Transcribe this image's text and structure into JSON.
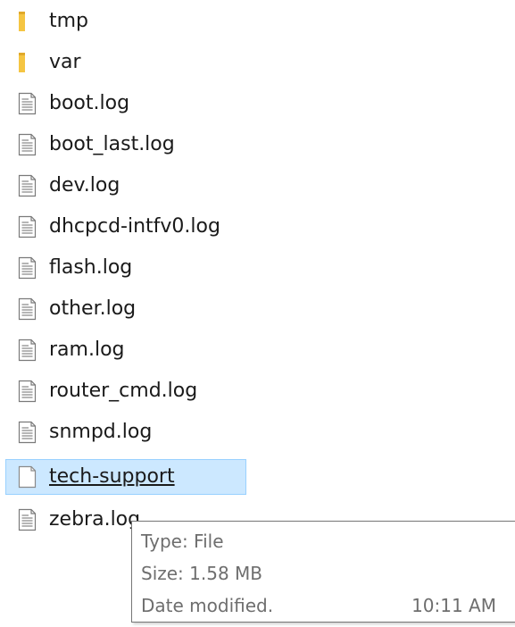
{
  "files": [
    {
      "name": "tmp",
      "icon": "folder-icon",
      "selected": false
    },
    {
      "name": "var",
      "icon": "folder-icon",
      "selected": false
    },
    {
      "name": "boot.log",
      "icon": "text-file-icon",
      "selected": false
    },
    {
      "name": "boot_last.log",
      "icon": "text-file-icon",
      "selected": false
    },
    {
      "name": "dev.log",
      "icon": "text-file-icon",
      "selected": false
    },
    {
      "name": "dhcpcd-intfv0.log",
      "icon": "text-file-icon",
      "selected": false
    },
    {
      "name": "flash.log",
      "icon": "text-file-icon",
      "selected": false
    },
    {
      "name": "other.log",
      "icon": "text-file-icon",
      "selected": false
    },
    {
      "name": "ram.log",
      "icon": "text-file-icon",
      "selected": false
    },
    {
      "name": "router_cmd.log",
      "icon": "text-file-icon",
      "selected": false
    },
    {
      "name": "snmpd.log",
      "icon": "text-file-icon",
      "selected": false
    },
    {
      "name": "tech-support",
      "icon": "blank-file-icon",
      "selected": true
    },
    {
      "name": "zebra.log",
      "icon": "text-file-icon",
      "selected": false
    }
  ],
  "tooltip": {
    "type_line": "Type: File",
    "size_line": "Size: 1.58 MB",
    "date_label": "Date modified.",
    "date_value": "10:11 AM"
  },
  "colors": {
    "selection_fill": "#cce8ff",
    "selection_border": "#99d1ff",
    "folder": "#f5c542",
    "tooltip_text": "#6e6e6e"
  }
}
